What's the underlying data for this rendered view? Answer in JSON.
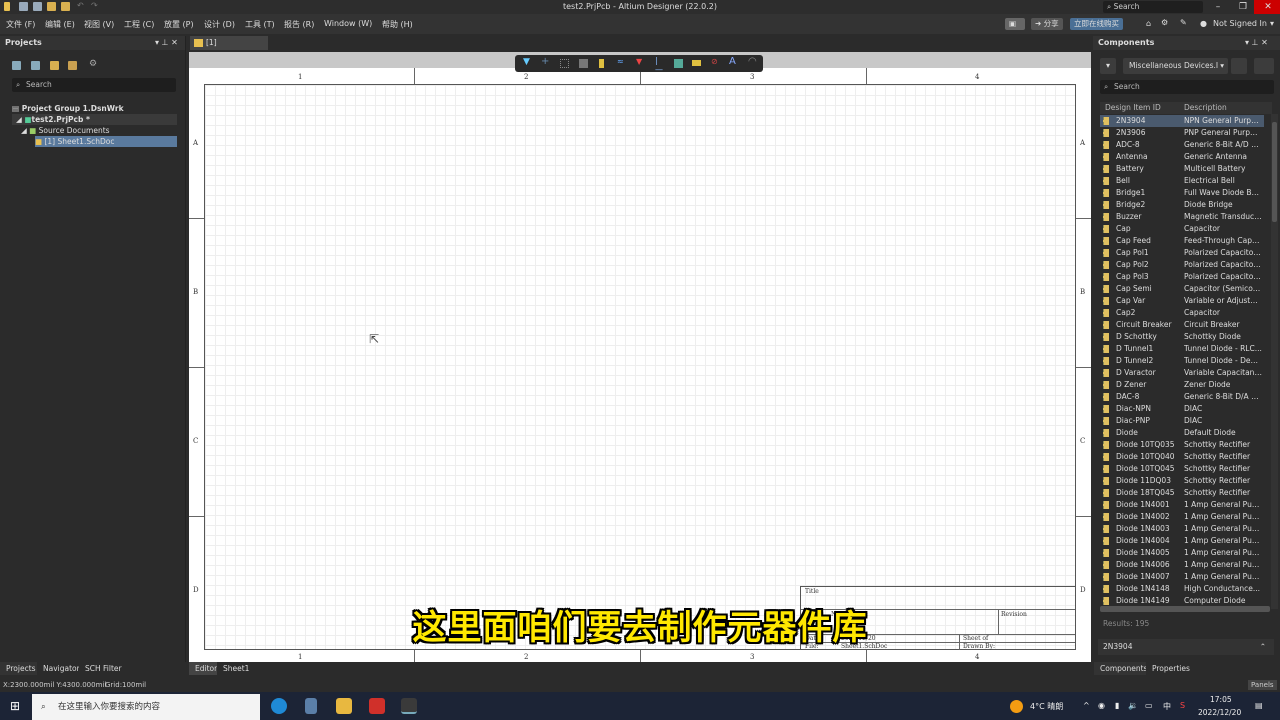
{
  "window": {
    "title": "test2.PrjPcb - Altium Designer (22.0.2)",
    "search_placeholder": "Search",
    "minimize": "–",
    "restore": "❐",
    "close": "✕"
  },
  "menu": [
    "文件 (F)",
    "编辑 (E)",
    "视图 (V)",
    "工程 (C)",
    "放置 (P)",
    "设计 (D)",
    "工具 (T)",
    "报告 (R)",
    "Window (W)",
    "帮助 (H)"
  ],
  "top_right": {
    "share": "分享",
    "buy": "立即在线购买",
    "user": "Not Signed In"
  },
  "projects": {
    "title": "Projects",
    "search_placeholder": "Search",
    "tree": [
      "Project Group 1.DsnWrk",
      "test2.PrjPcb *",
      "Source Documents",
      "[1] Sheet1.SchDoc"
    ]
  },
  "doc_tab": "[1] Sheet1.SchDoc",
  "sheet": {
    "columns": [
      "1",
      "2",
      "3",
      "4"
    ],
    "rows": [
      "A",
      "B",
      "C",
      "D"
    ],
    "title_block": {
      "title": "Title",
      "size": "Size",
      "number": "Number",
      "revision": "Revision",
      "date": "Date:",
      "date_value": "2022/12/20",
      "file": "File:",
      "file_value": "Sheet1.SchDoc",
      "sheet_of": "Sheet  of",
      "drawn_by": "Drawn By:"
    }
  },
  "caption": "这里面咱们要去制作元器件库",
  "components": {
    "title": "Components",
    "library": "Miscellaneous Devices.I",
    "search_placeholder": "Search",
    "col_id": "Design Item ID",
    "col_desc": "Description",
    "results": "Results: 195",
    "selected": "2N3904",
    "items": [
      [
        "2N3904",
        "NPN General Purpos..."
      ],
      [
        "2N3906",
        "PNP General Purpos..."
      ],
      [
        "ADC-8",
        "Generic 8-Bit A/D Co..."
      ],
      [
        "Antenna",
        "Generic Antenna"
      ],
      [
        "Battery",
        "Multicell Battery"
      ],
      [
        "Bell",
        "Electrical Bell"
      ],
      [
        "Bridge1",
        "Full Wave Diode Bri..."
      ],
      [
        "Bridge2",
        "Diode Bridge"
      ],
      [
        "Buzzer",
        "Magnetic Transduce..."
      ],
      [
        "Cap",
        "Capacitor"
      ],
      [
        "Cap Feed",
        "Feed-Through Capa..."
      ],
      [
        "Cap Pol1",
        "Polarized Capacitor..."
      ],
      [
        "Cap Pol2",
        "Polarized Capacitor..."
      ],
      [
        "Cap Pol3",
        "Polarized Capacitor..."
      ],
      [
        "Cap Semi",
        "Capacitor (Semicon..."
      ],
      [
        "Cap Var",
        "Variable or Adjustab..."
      ],
      [
        "Cap2",
        "Capacitor"
      ],
      [
        "Circuit Breaker",
        "Circuit Breaker"
      ],
      [
        "D Schottky",
        "Schottky Diode"
      ],
      [
        "D Tunnel1",
        "Tunnel Diode - RLC..."
      ],
      [
        "D Tunnel2",
        "Tunnel Diode - Dep..."
      ],
      [
        "D Varactor",
        "Variable Capacitanc..."
      ],
      [
        "D Zener",
        "Zener Diode"
      ],
      [
        "DAC-8",
        "Generic 8-Bit D/A Co..."
      ],
      [
        "Diac-NPN",
        "DIAC"
      ],
      [
        "Diac-PNP",
        "DIAC"
      ],
      [
        "Diode",
        "Default Diode"
      ],
      [
        "Diode 10TQ035",
        "Schottky Rectifier"
      ],
      [
        "Diode 10TQ040",
        "Schottky Rectifier"
      ],
      [
        "Diode 10TQ045",
        "Schottky Rectifier"
      ],
      [
        "Diode 11DQ03",
        "Schottky Rectifier"
      ],
      [
        "Diode 18TQ045",
        "Schottky Rectifier"
      ],
      [
        "Diode 1N4001",
        "1 Amp General Purp..."
      ],
      [
        "Diode 1N4002",
        "1 Amp General Purp..."
      ],
      [
        "Diode 1N4003",
        "1 Amp General Purp..."
      ],
      [
        "Diode 1N4004",
        "1 Amp General Purp..."
      ],
      [
        "Diode 1N4005",
        "1 Amp General Purp..."
      ],
      [
        "Diode 1N4006",
        "1 Amp General Purp..."
      ],
      [
        "Diode 1N4007",
        "1 Amp General Purp..."
      ],
      [
        "Diode 1N4148",
        "High Conductance..."
      ],
      [
        "Diode 1N4149",
        "Computer Diode"
      ]
    ]
  },
  "bottom_tabs_left": [
    "Projects",
    "Navigator",
    "SCH Filter"
  ],
  "bottom_tabs_editor": [
    "Editor",
    "Sheet1"
  ],
  "bottom_tabs_right": [
    "Components",
    "Properties"
  ],
  "status": {
    "coords": "X:2300.000mil Y:4300.000mil",
    "grid": "Grid:100mil",
    "panels": "Panels"
  },
  "taskbar": {
    "search_placeholder": "在这里输入你要搜索的内容",
    "weather": "4°C  晴朗",
    "ime": "中",
    "time": "17:05",
    "date": "2022/12/20"
  }
}
